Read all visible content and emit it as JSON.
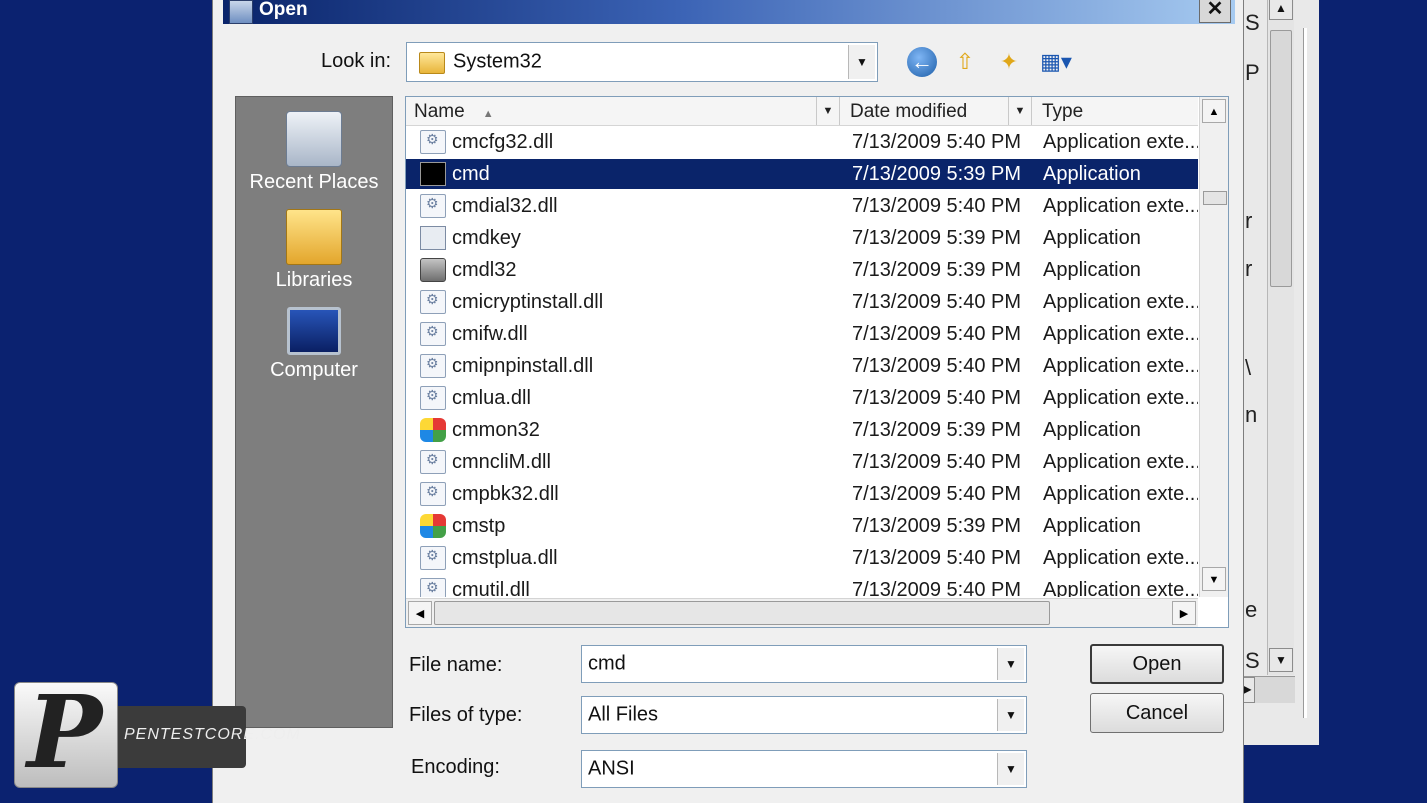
{
  "dialog": {
    "title": "Open",
    "close_glyph": "✕"
  },
  "look_in": {
    "label": "Look in:",
    "value": "System32"
  },
  "places": [
    {
      "label": "Recent Places",
      "icon": "recent-places-icon"
    },
    {
      "label": "Libraries",
      "icon": "libraries-icon"
    },
    {
      "label": "Computer",
      "icon": "computer-icon"
    }
  ],
  "columns": {
    "name": "Name",
    "date": "Date modified",
    "type": "Type"
  },
  "files": [
    {
      "name": "cmcfg32.dll",
      "date": "7/13/2009 5:40 PM",
      "type": "Application exte...",
      "icon": "dll"
    },
    {
      "name": "cmd",
      "date": "7/13/2009 5:39 PM",
      "type": "Application",
      "icon": "exe-cmd",
      "selected": true
    },
    {
      "name": "cmdial32.dll",
      "date": "7/13/2009 5:40 PM",
      "type": "Application exte...",
      "icon": "dll"
    },
    {
      "name": "cmdkey",
      "date": "7/13/2009 5:39 PM",
      "type": "Application",
      "icon": "exe-win"
    },
    {
      "name": "cmdl32",
      "date": "7/13/2009 5:39 PM",
      "type": "Application",
      "icon": "exe-gear"
    },
    {
      "name": "cmicryptinstall.dll",
      "date": "7/13/2009 5:40 PM",
      "type": "Application exte...",
      "icon": "dll"
    },
    {
      "name": "cmifw.dll",
      "date": "7/13/2009 5:40 PM",
      "type": "Application exte...",
      "icon": "dll"
    },
    {
      "name": "cmipnpinstall.dll",
      "date": "7/13/2009 5:40 PM",
      "type": "Application exte...",
      "icon": "dll"
    },
    {
      "name": "cmlua.dll",
      "date": "7/13/2009 5:40 PM",
      "type": "Application exte...",
      "icon": "dll"
    },
    {
      "name": "cmmon32",
      "date": "7/13/2009 5:39 PM",
      "type": "Application",
      "icon": "exe-color"
    },
    {
      "name": "cmncliM.dll",
      "date": "7/13/2009 5:40 PM",
      "type": "Application exte...",
      "icon": "dll"
    },
    {
      "name": "cmpbk32.dll",
      "date": "7/13/2009 5:40 PM",
      "type": "Application exte...",
      "icon": "dll"
    },
    {
      "name": "cmstp",
      "date": "7/13/2009 5:39 PM",
      "type": "Application",
      "icon": "exe-color"
    },
    {
      "name": "cmstplua.dll",
      "date": "7/13/2009 5:40 PM",
      "type": "Application exte...",
      "icon": "dll"
    },
    {
      "name": "cmutil.dll",
      "date": "7/13/2009 5:40 PM",
      "type": "Application exte...",
      "icon": "dll"
    }
  ],
  "form": {
    "file_name_label": "File name:",
    "file_name_value": "cmd",
    "files_of_type_label": "Files of type:",
    "files_of_type_value": "All Files",
    "encoding_label": "Encoding:",
    "encoding_value": "ANSI"
  },
  "buttons": {
    "open": "Open",
    "cancel": "Cancel"
  },
  "background_window": {
    "letters": [
      "S",
      "P",
      "r",
      "r",
      "\\",
      "n",
      "e",
      "S"
    ]
  },
  "watermark": {
    "logo_letter": "P",
    "site": "PENTESTCORE.COM"
  },
  "colors": {
    "desktop": "#0b2270",
    "selection": "#0a246a"
  }
}
